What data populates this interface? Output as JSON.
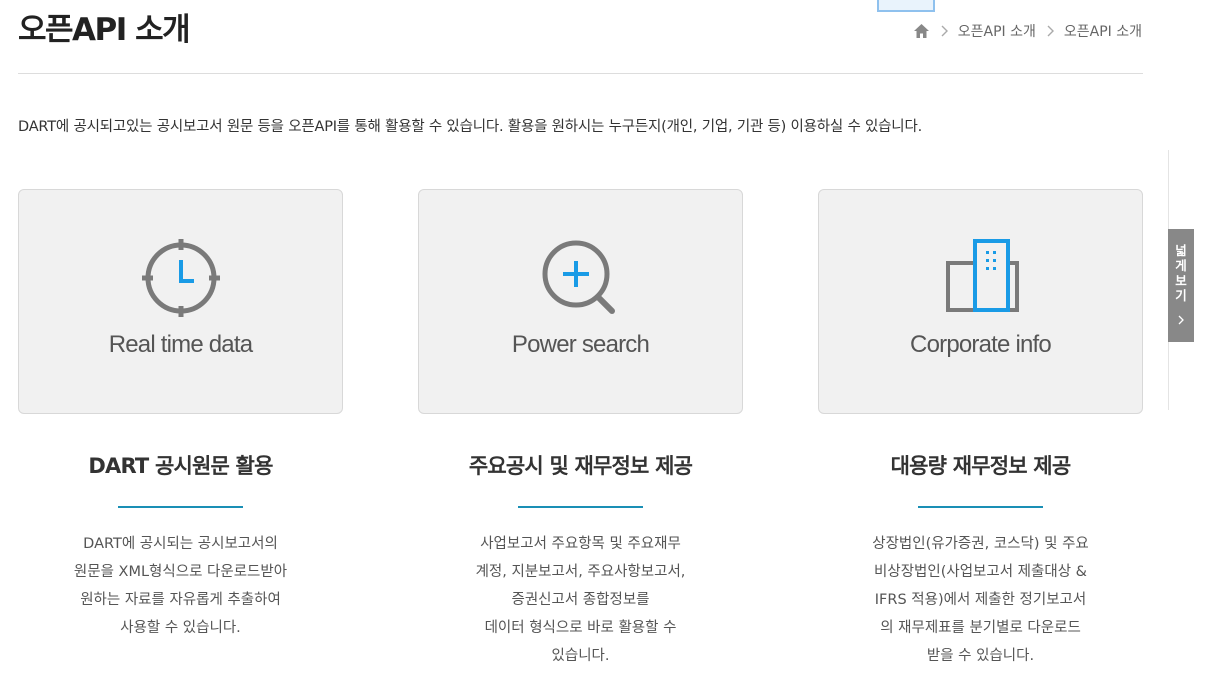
{
  "page": {
    "title": "오픈API 소개",
    "breadcrumb": [
      "오픈API 소개",
      "오픈API 소개"
    ],
    "intro": "DART에 공시되고있는 공시보고서 원문 등을 오픈API를 통해 활용할 수 있습니다. 활용을 원하시는 누구든지(개인, 기업, 기관 등) 이용하실 수 있습니다."
  },
  "cards": [
    {
      "icon": "clock-icon",
      "label": "Real time data",
      "title": "DART 공시원문 활용",
      "desc": [
        "DART에 공시되는 공시보고서의",
        "원문을 XML형식으로 다운로드받아",
        "원하는 자료를 자유롭게 추출하여",
        "사용할 수 있습니다."
      ]
    },
    {
      "icon": "search-icon",
      "label": "Power search",
      "title": "주요공시 및 재무정보 제공",
      "desc": [
        "사업보고서 주요항목 및 주요재무",
        "계정, 지분보고서, 주요사항보고서,",
        "증권신고서 종합정보를",
        "데이터 형식으로 바로 활용할 수",
        "있습니다."
      ]
    },
    {
      "icon": "building-icon",
      "label": "Corporate info",
      "title": "대용량 재무정보 제공",
      "desc": [
        "상장법인(유가증권, 코스닥) 및 주요",
        "비상장법인(사업보고서 제출대상 &",
        "IFRS 적용)에서 제출한 정기보고서",
        "의 재무제표를 분기별로 다운로드",
        "받을 수 있습니다."
      ]
    }
  ],
  "side_tab": {
    "label": "넓게보기"
  },
  "colors": {
    "accent": "#1a8fb5",
    "icon_blue": "#1a9be6",
    "icon_gray": "#7a7a7a"
  }
}
